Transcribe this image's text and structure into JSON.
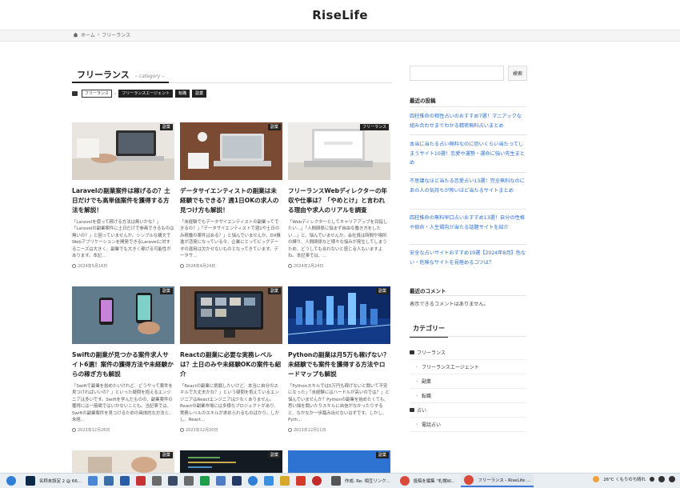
{
  "site": {
    "title": "RiseLife"
  },
  "breadcrumb": {
    "home": "ホーム",
    "sep": "›",
    "current": "フリーランス"
  },
  "category": {
    "title": "フリーランス",
    "subtitle": "– category –"
  },
  "tags": [
    "フリーランス",
    "›",
    "フリーランスエージェント",
    "転職",
    "副業"
  ],
  "posts": [
    {
      "badge": "副業",
      "title": "Laravelの副業案件は稼げるの？土日だけでも高単価案件を獲得する方法を解説！",
      "excerpt": "「Laravelを使って稼げる方法は無いかな？」「Laravelの副業案件に土日だけで参画できるものは無いの？」と困っていませんか。シンプルな構文でWebアプリケーションを開発できるLaravelに対するニーズは大きく、副業でも大きく稼げる可能性があります。本記…",
      "date": "2024年5月16日"
    },
    {
      "badge": "副業",
      "title": "データサイエンティストの副業は未経験でもできる？週1日OKの求人の見つけ方も解説！",
      "excerpt": "「未経験でもデータサイエンティストの副業ってできるの？」「データサイエンティストで週1や土日のみ稼働の案件はある？」と悩んでいませんか。DX推進が活発になっている今、企業にとってビッグデータの運用は欠かせないものとなってきています。データサ…",
      "date": "2024年4月24日"
    },
    {
      "badge": "フリーランス",
      "title": "フリーランスWebディレクターの年収や仕事は？「やめとけ」と言われる理由や求人のリアルを調査",
      "excerpt": "「Webディレクターとしてキャリアアップを目指したい…」「人間関係に悩まず自由な働き方をしたい…」と、悩んでいませんか。会社員は時間や場所の縛り、人間関係など様々な悩みが発生してしまうため、どうしても合わないと感じる人もいますよね。本記事では、…",
      "date": "2024年2月24日"
    },
    {
      "badge": "副業",
      "title": "Swiftの副業が見つかる案件求人サイト6選！案件の獲得方法や未経験からの稼ぎ方も解説",
      "excerpt": "「Swiftで副業を始めたいけれど、どうやって案件を見つければいいの？」といった疑問を抱えるエンジニアは多いです。Swiftを学んだものの、副業案件の獲得には一筋縄ではいかないことも。当記事では、Swiftの副業案件を見つけるための具体的な方法と、未経…",
      "date": "2023年12月26日"
    },
    {
      "badge": "副業",
      "title": "Reactの副業に必要な実務レベルは？土日のみや未経験OKの案件も紹介",
      "excerpt": "「Reactの副業に挑戦したいけど、本当に自分のスキルで大丈夫かな？」という疑問を抱えているエンジニアはReactエンジニアは少なくありません。Reactの副業市場には多様なプロジェクトがあり、実務レベルのスキルが求められるものばかり。しかし、React…",
      "date": "2023年12月20日"
    },
    {
      "badge": "副業",
      "title": "Pythonの副業は月5万も稼げない？未経験でも案件を獲得する方法やロードマップも解説",
      "excerpt": "「Pythonスキルでは5万円も稼げないと聞いて不安になった」「未経験にはハードルが高いのでは？」と悩んでいませんか？Pythonの副業を始めたくても、思い描を聞いたりスキルに自信がなかったりすると、なかなか一歩踏み出せないはずです。しかし、Pyth…",
      "date": "2023年12月11日"
    },
    {
      "badge": "副業"
    },
    {
      "badge": "副業"
    },
    {
      "badge": "副業"
    }
  ],
  "sidebar": {
    "search_placeholder": "",
    "search_button": "検索",
    "recent_heading": "最近の投稿",
    "recent_posts": [
      "四柱推命の相性占いのおすすめ7選！マニアックな組み合わせまでわかる精密無料占いまとめ",
      "本当に当たる占い無料なのに恐いくらい当たってしまうサイト10選！恋愛や運勢・運命に強い先生まとめ",
      "不思議なほど当たる恋愛占い13選！完全無料なのにあの人の気持ちが怖いほど当たるサイトまとめ",
      "四柱推命の無料早口占いおすすめ13選！自分の性格や宿命・人生傾向が当たる話題サイトを紹介",
      "安全な占いサイトおすすめ19選【2024年8月】危ない・危険なサイトを見極めるコツは？"
    ],
    "comments_heading": "最近のコメント",
    "no_comments": "表示できるコメントはありません。",
    "categories_heading": "カテゴリー",
    "categories": [
      {
        "label": "フリーランス",
        "level": 0
      },
      {
        "label": "フリーランスエージェント",
        "level": 1
      },
      {
        "label": "副業",
        "level": 1
      },
      {
        "label": "転職",
        "level": 1
      },
      {
        "label": "占い",
        "level": 0
      },
      {
        "label": "電話占い",
        "level": 1
      }
    ]
  },
  "taskbar": {
    "tasks": [
      "名称未設定 2 @ 66...",
      "作成: Re: 相互リンク...",
      "投稿を編集 \"札幌W...",
      "フリーランス - RiseLife ..."
    ],
    "weather": "26°C くもりのち晴れ",
    "colors": {
      "accent": "#3a78d8"
    }
  }
}
